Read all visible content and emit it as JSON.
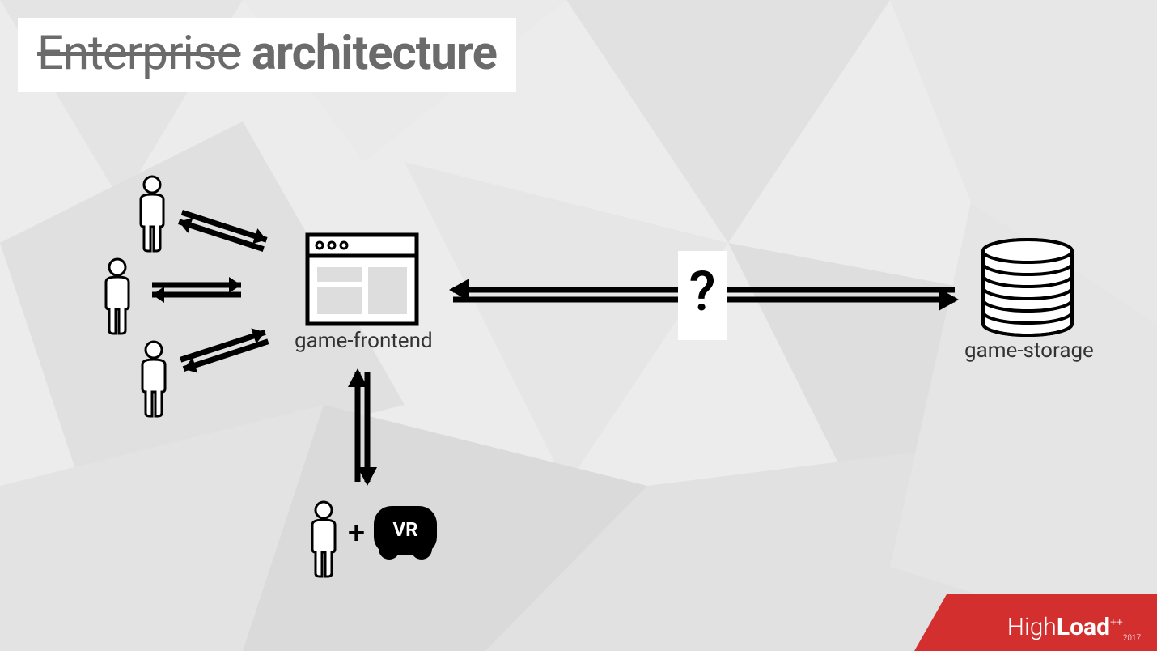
{
  "title": {
    "strike": "Enterprise",
    "main": " architecture"
  },
  "nodes": {
    "frontend_label": "game-frontend",
    "storage_label": "game-storage",
    "question": "?",
    "plus": "+",
    "vr": "VR"
  },
  "logo": {
    "brand_light": "High",
    "brand_bold": "Load",
    "plus": "++",
    "year": "2017"
  }
}
